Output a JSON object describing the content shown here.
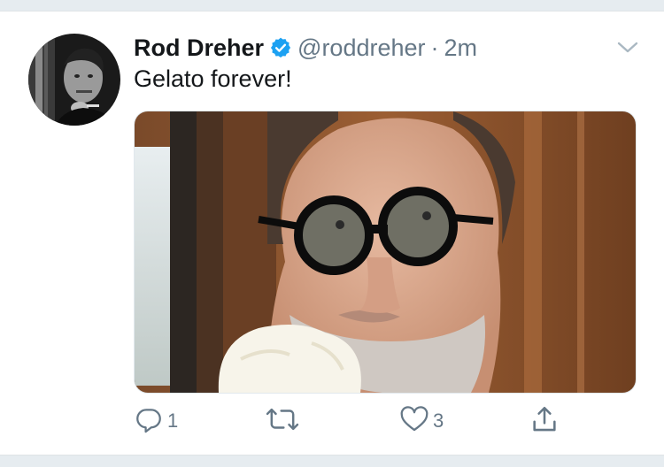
{
  "tweet": {
    "author_name": "Rod Dreher",
    "handle": "@roddreher",
    "separator": "·",
    "time": "2m",
    "text": "Gelato forever!",
    "verified": true,
    "media_description_icon": "photo",
    "actions": {
      "reply_count": "1",
      "retweet_count": "",
      "like_count": "3"
    }
  },
  "colors": {
    "name": "#14171a",
    "secondary": "#657786",
    "verified": "#1da1f2",
    "frame": "#e6ecf0"
  },
  "icons": {
    "verified": "verified-badge-icon",
    "caret": "chevron-down-icon",
    "reply": "reply-icon",
    "retweet": "retweet-icon",
    "like": "heart-icon",
    "share": "share-icon"
  }
}
